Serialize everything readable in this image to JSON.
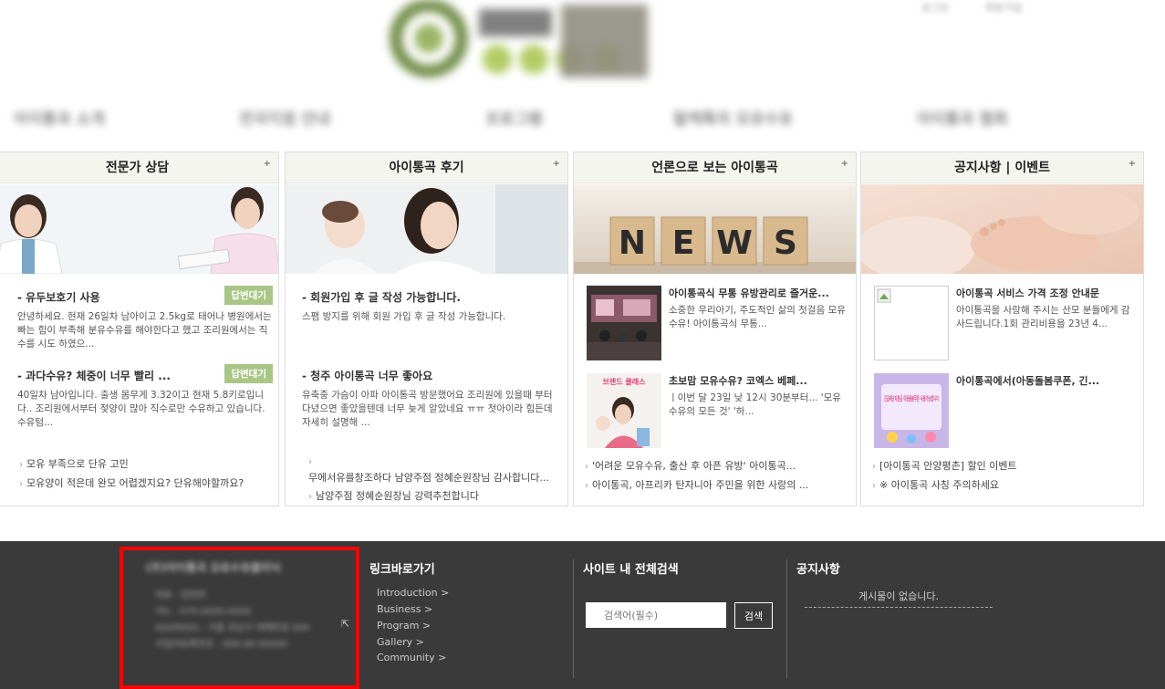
{
  "header": {
    "logo_text": "아이통곡",
    "util_links": [
      "로그인",
      "회원가입"
    ],
    "gnb": [
      "아이통곡 소개",
      "전국지점 안내",
      "프로그램",
      "탈케톡의 모유수유",
      "아이통곡 협회"
    ]
  },
  "boxes": [
    {
      "title": "전문가 상담",
      "more": "+",
      "posts": [
        {
          "title": "- 유두보호기 사용",
          "badge": "답변대기",
          "body": "안녕하세요. 현재 26일차 남아이고 2.5kg로 태어나 병원에서는 빠는 힘이 부족해 분유수유를 해야한다고 했고 조리원에서는 직수를 시도 하였으..."
        },
        {
          "title": "- 과다수유? 체중이 너무 빨리 ...",
          "badge": "답변대기",
          "body": "40일차 남아입니다. 출생 몸무게 3.32이고 현재 5.8키로입니다.. 조리원에서부터 젖양이 많아 직수로만 수유하고 있습니다.수유텀..."
        }
      ],
      "links": [
        "모유 부족으로 단유 고민",
        "모유양이 적은데 완모 어렵겠지요? 단유해야할까요?"
      ]
    },
    {
      "title": "아이통곡 후기",
      "more": "+",
      "posts": [
        {
          "title": "- 회원가입 후 글 작성 가능합니다.",
          "body": "스팸 방지를 위해 회원 가입 후 글 작성 가능합니다."
        },
        {
          "title": "- 청주 아이통곡 너무 좋아요",
          "body": "유축중 가슴이 아파 아이통곡 방문했어요 조리원에 있을때 부터 다녔으면 좋았을텐데 너무 늦게 알았네요 ㅠㅠ 첫아이라 힘든데 자세히 설명해 ..."
        }
      ],
      "links": [
        "",
        "무에서유를창조하다 남양주점 정혜순원장님 감사합니다...",
        "남양주점 정혜순원장님 강력추천합니다"
      ]
    },
    {
      "title": "언론으로 보는 아이통곡",
      "more": "+",
      "news_text": "NEWS",
      "minis": [
        {
          "title": "아이통곡식 무통 유방관리로 즐거운...",
          "body": "소중한 우리아기, 주도적인 삶의 첫걸음 모유수유! 아이통곡식 무통..."
        },
        {
          "title": "초보맘 모유수유? 코엑스 베페...",
          "body": "ㅣ이번 달 23일 낮 12시 30분부터... '모유수유의 모든 것' '하...",
          "thumb_text": "브랜드 클래스"
        }
      ],
      "links": [
        "'어려운 모유수유, 출산 후 아픈 유방' 아이통곡...",
        "아이통곡, 아프리카 탄자니아 주민을 위한 사랑의 ..."
      ]
    },
    {
      "title": "공지사항 | 이벤트",
      "more": "+",
      "minis": [
        {
          "title": "아이통곡 서비스 가격 조정 안내문",
          "body": "아이통곡을 사랑해 주시는 산모 분들에게 감사드립니다.1회 관리비용을 23년 4..."
        },
        {
          "title": "아이통곡에서(아동돌봄쿠폰, 긴...",
          "body": "",
          "thumb_text": "긴급재난지원금 아동돌봄쿠폰 사용가능합니다"
        }
      ],
      "links": [
        "[아이통곡 안양평촌] 할인 이벤트",
        "※ 아이통곡 사칭 주의하세요"
      ]
    }
  ],
  "footer": {
    "company_lines": [
      "(주)아이통곡 모유수유클리닉",
      "대표 : 임현희",
      "TEL : 070-0000-0000",
      "ADDRESS : 서울 강남구 테헤란로 000",
      "사업자등록번호 : 000-00-00000"
    ],
    "links_title": "링크바로가기",
    "links": [
      "Introduction >",
      "Business >",
      "Program >",
      "Gallery >",
      "Community >"
    ],
    "search_title": "사이트 내 전체검색",
    "search_placeholder": "검색어(필수)",
    "search_button": "검색",
    "notice_title": "공지사항",
    "notice_empty": "게시물이 없습니다."
  }
}
